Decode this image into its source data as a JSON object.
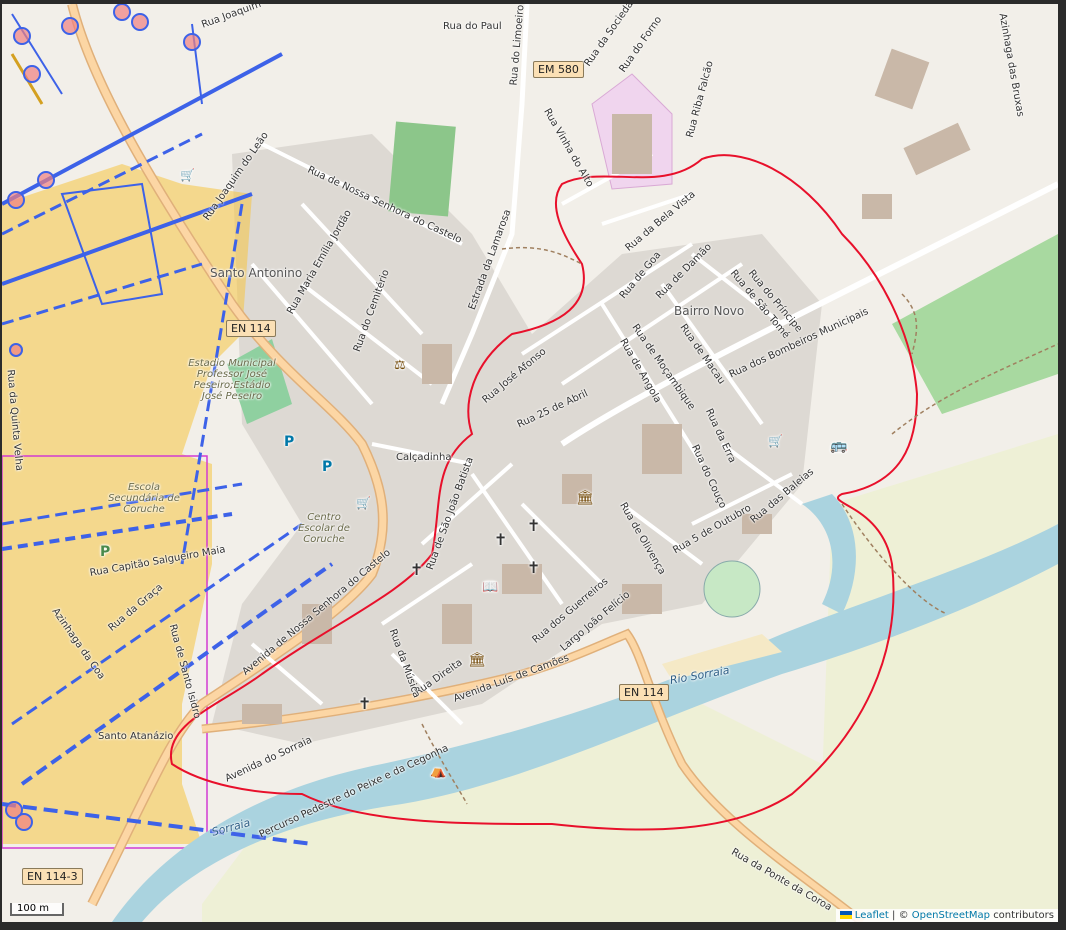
{
  "map": {
    "places": {
      "santo_antonino": "Santo Antonino",
      "bairro_novo": "Bairro Novo",
      "santo_atanazio": "Santo Atanázio"
    },
    "river": [
      "Rio Sorraia",
      "Sorraia"
    ],
    "shields": [
      "EN 114",
      "EN 114",
      "EM 580",
      "EN 114-3"
    ],
    "amenities": [
      "Estadio Municipal Professor José Peseiro;Estádio José Peseiro",
      "Escola Secundária de Coruche",
      "Centro Escolar de Coruche"
    ],
    "streets": [
      "Rua Joaquim",
      "Rua do Paul",
      "Rua do Limoeiro",
      "Rua da Sociedade",
      "Rua do Forno",
      "Rua Riba Falcão",
      "Azinhaga das Bruxas",
      "Rua Vinha do Alto",
      "Rua de Nossa Senhora do Castelo",
      "Rua Joaquim do Leão",
      "Rua Maria Emília Jordão",
      "Rua do Cemitério",
      "Estrada da Lamarosa",
      "Rua da Bela Vista",
      "Rua de Goa",
      "Rua de Damão",
      "Rua de São Tomé",
      "Rua do Príncipe",
      "Rua de Moçambique",
      "Rua de Macau",
      "Rua de Angola",
      "Rua dos Bombeiros Municipais",
      "Rua José Afonso",
      "Rua 25 de Abril",
      "Rua da Erra",
      "Rua do Couço",
      "Rua das Baleias",
      "Rua 5 de Outubro",
      "Rua de Olivença",
      "Calçadinha",
      "Rua de São João Batista",
      "Rua dos Guerreiros",
      "Largo João Felício",
      "Avenida Luís de Camões",
      "Rua Direita",
      "Rua da Música",
      "Avenida de Nossa Senhora do Castelo",
      "Rua Capitão Salgueiro Maia",
      "Azinhaga da Coa",
      "Rua da Graça",
      "Rua de Santo Isidro",
      "Rua da Quinta Velha",
      "Avenida do Sorraia",
      "Percurso Pedestre do Peixe e da Cegonha",
      "Rua da Ponte da Coroa"
    ]
  },
  "controls": {
    "scale": "100 m",
    "attribution_leaflet": "Leaflet",
    "attribution_sep": "| ©",
    "attribution_osm": "OpenStreetMap",
    "attribution_tail": "contributors"
  },
  "colors": {
    "background": "#f2efe9",
    "water": "#aad3df",
    "road_major": "#fcd6a4",
    "highlight_line": "#e8102b",
    "overlay_blue": "#3d62e8",
    "overlay_yellow": "#f5c542",
    "overlay_magenta": "#d23ad2"
  },
  "icons": [
    "parking-icon",
    "shop-icon",
    "church-icon",
    "museum-icon",
    "bus-icon",
    "picnic-icon",
    "courthouse-icon",
    "library-icon"
  ]
}
